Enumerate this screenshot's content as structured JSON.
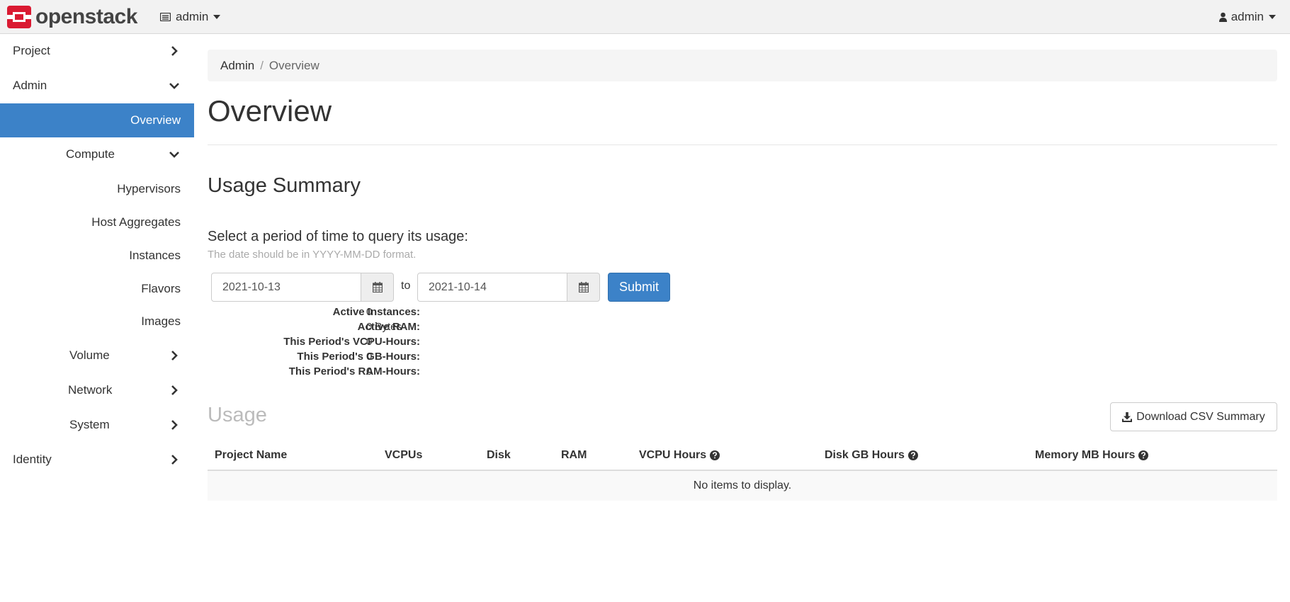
{
  "header": {
    "brand": "openstack",
    "project_switcher": "admin",
    "user_menu": "admin"
  },
  "sidebar": {
    "items": [
      {
        "label": "Project"
      },
      {
        "label": "Admin"
      },
      {
        "label": "Overview"
      },
      {
        "label": "Compute"
      },
      {
        "label": "Hypervisors"
      },
      {
        "label": "Host Aggregates"
      },
      {
        "label": "Instances"
      },
      {
        "label": "Flavors"
      },
      {
        "label": "Images"
      },
      {
        "label": "Volume"
      },
      {
        "label": "Network"
      },
      {
        "label": "System"
      },
      {
        "label": "Identity"
      }
    ]
  },
  "breadcrumb": {
    "parent": "Admin",
    "separator": "/",
    "current": "Overview"
  },
  "page": {
    "title": "Overview",
    "usage_summary_title": "Usage Summary",
    "query_label": "Select a period of time to query its usage:",
    "query_help": "The date should be in YYYY-MM-DD format.",
    "start_date": "2021-10-13",
    "to_label": "to",
    "end_date": "2021-10-14",
    "submit_label": "Submit"
  },
  "stats": [
    {
      "label": "Active Instances:",
      "value": "0"
    },
    {
      "label": "Active RAM:",
      "value": "0 Bytes"
    },
    {
      "label": "This Period's VCPU-Hours:",
      "value": "0"
    },
    {
      "label": "This Period's GB-Hours:",
      "value": "0"
    },
    {
      "label": "This Period's RAM-Hours:",
      "value": "0"
    }
  ],
  "usage": {
    "title": "Usage",
    "download_label": "Download CSV Summary",
    "columns": [
      "Project Name",
      "VCPUs",
      "Disk",
      "RAM",
      "VCPU Hours",
      "Disk GB Hours",
      "Memory MB Hours"
    ],
    "empty_message": "No items to display."
  },
  "colors": {
    "accent": "#3c82c8",
    "brand_red": "#da1a32"
  }
}
